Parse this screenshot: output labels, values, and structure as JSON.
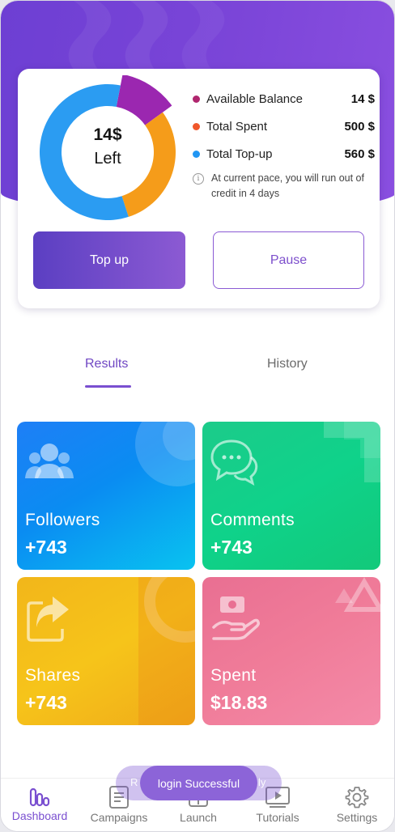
{
  "balance_card": {
    "donut_amount": "14$",
    "donut_caption": "Left",
    "donut_segments": [
      {
        "name": "Available Balance",
        "fraction": 0.12,
        "color": "#9b27b0"
      },
      {
        "name": "Total Spent",
        "fraction": 0.3,
        "color": "#f59c1a"
      },
      {
        "name": "Total Top-up",
        "fraction": 0.58,
        "color": "#2b9cf2"
      }
    ],
    "legend": [
      {
        "label": "Available Balance",
        "value": "14 $",
        "color": "#b0266e"
      },
      {
        "label": "Total Spent",
        "value": "500 $",
        "color": "#f0572b"
      },
      {
        "label": "Total Top-up",
        "value": "560 $",
        "color": "#2196f3"
      }
    ],
    "note": "At current pace, you will run out of credit in 4 days",
    "info_icon": "info-icon",
    "topup_label": "Top up",
    "pause_label": "Pause"
  },
  "tabs": {
    "results": "Results",
    "history": "History",
    "active": "Results"
  },
  "tiles": [
    {
      "title": "Followers",
      "value": "+743",
      "icon": "people-icon"
    },
    {
      "title": "Comments",
      "value": "+743",
      "icon": "chat-bubbles-icon"
    },
    {
      "title": "Shares",
      "value": "+743",
      "icon": "share-icon"
    },
    {
      "title": "Spent",
      "value": "$18.83",
      "icon": "money-hand-icon"
    }
  ],
  "toast": {
    "message": "login Successful",
    "ghost_left": "R",
    "ghost_right": "ly"
  },
  "bottom_nav": [
    {
      "label": "Dashboard",
      "icon": "bar-chart-icon",
      "active": true
    },
    {
      "label": "Campaigns",
      "icon": "document-icon",
      "active": false
    },
    {
      "label": "Launch",
      "icon": "launch-icon",
      "active": false
    },
    {
      "label": "Tutorials",
      "icon": "video-icon",
      "active": false
    },
    {
      "label": "Settings",
      "icon": "gear-icon",
      "active": false
    }
  ],
  "colors": {
    "brand_purple": "#7a4fd0",
    "header_gradient": [
      "#6d3fd3",
      "#8a4fe0"
    ]
  }
}
